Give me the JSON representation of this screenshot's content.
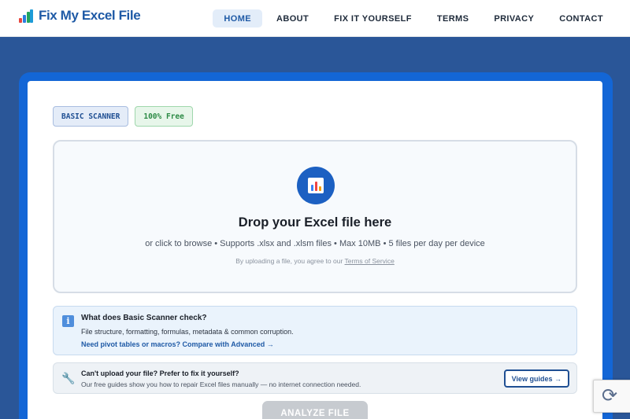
{
  "brand": {
    "name": "Fix My Excel File"
  },
  "nav": {
    "items": [
      {
        "label": "HOME",
        "active": true
      },
      {
        "label": "ABOUT"
      },
      {
        "label": "FIX IT YOURSELF"
      },
      {
        "label": "TERMS"
      },
      {
        "label": "PRIVACY"
      },
      {
        "label": "CONTACT"
      }
    ]
  },
  "badges": {
    "scanner": "BASIC SCANNER",
    "free": "100% Free"
  },
  "dropzone": {
    "title": "Drop your Excel file here",
    "subtitle": "or click to browse • Supports .xlsx and .xlsm files • Max 10MB • 5 files per day per device",
    "terms_prefix": "By uploading a file, you agree to our ",
    "terms_link": "Terms of Service"
  },
  "info": {
    "title": "What does Basic Scanner check?",
    "text": "File structure, formatting, formulas, metadata & common corruption.",
    "link": "Need pivot tables or macros? Compare with Advanced →"
  },
  "diy": {
    "title": "Can't upload your file? Prefer to fix it yourself?",
    "text": "Our free guides show you how to repair Excel files manually — no internet connection needed.",
    "button": "View guides →"
  },
  "analyze": {
    "label": "ANALYZE FILE"
  },
  "colors": {
    "primary": "#1f5aa6",
    "background": "#2a5698",
    "frame": "#1366d6",
    "free_green": "#2c8a45"
  }
}
